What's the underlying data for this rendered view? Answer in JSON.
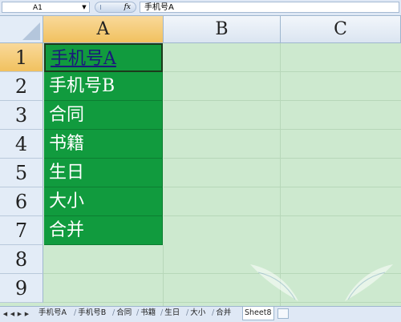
{
  "formula_bar": {
    "name_box": "A1",
    "fx_label": "fx",
    "content": "手机号A"
  },
  "columns": [
    "A",
    "B",
    "C"
  ],
  "rows": [
    "1",
    "2",
    "3",
    "4",
    "5",
    "6",
    "7",
    "8",
    "9"
  ],
  "cells_A": [
    "手机号A",
    "手机号B",
    "合同",
    "书籍",
    "生日",
    "大小",
    "合并"
  ],
  "sheet_tabs": [
    "手机号A",
    "手机号B",
    "合同",
    "书籍",
    "生日",
    "大小",
    "合并",
    "Sheet8"
  ],
  "active_tab": "Sheet8",
  "colors": {
    "fill_green": "#119b3e",
    "grid_bg": "#cde9cf",
    "header_selected": "#f1c15f"
  }
}
